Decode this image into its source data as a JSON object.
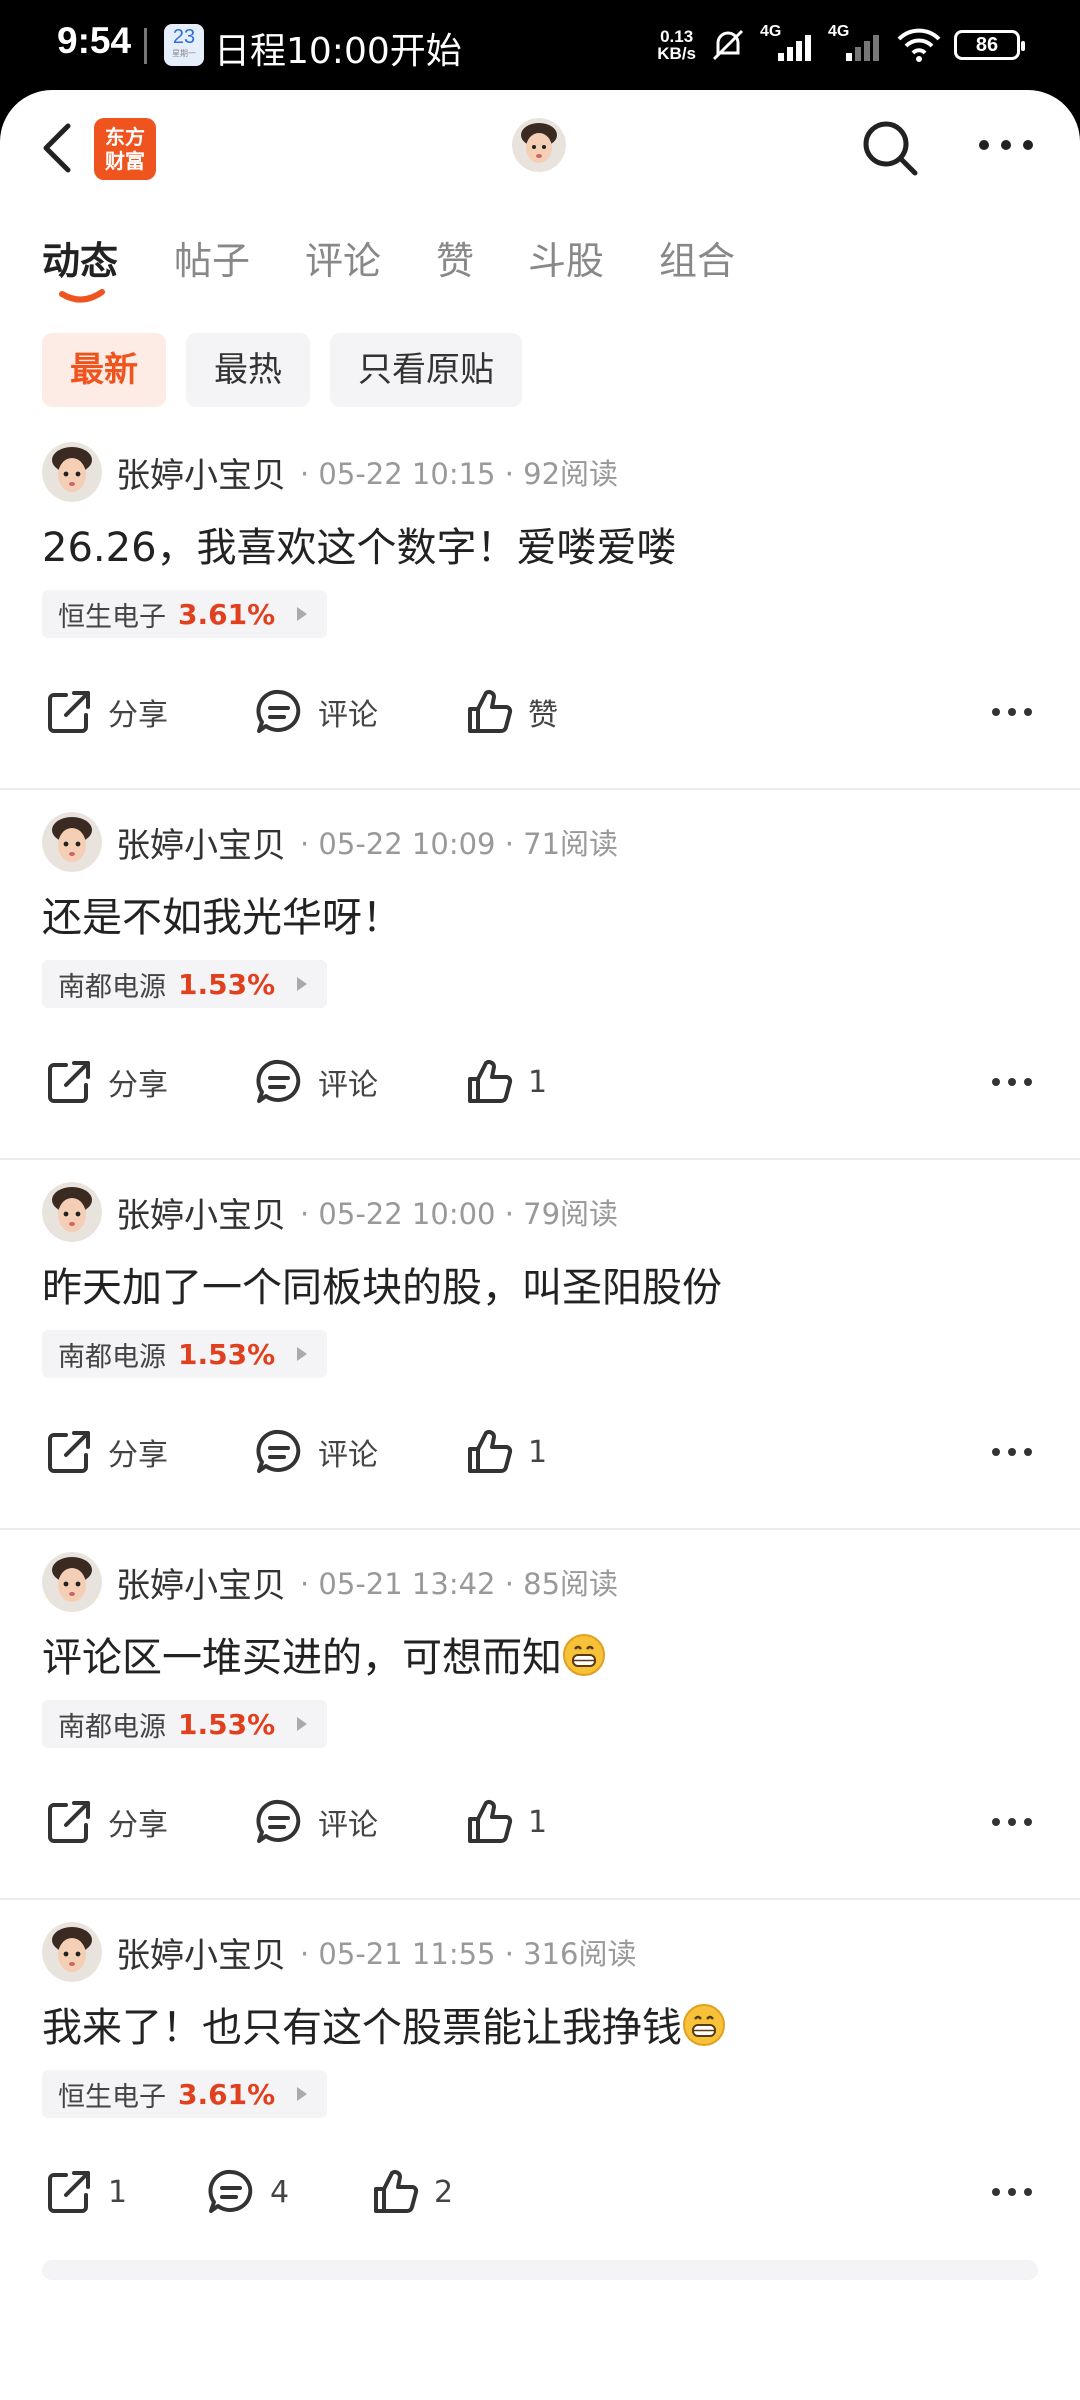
{
  "status_bar": {
    "time": "9:54",
    "calendar_day": "23",
    "calendar_sub": "星期一",
    "event": "日程10:00开始",
    "net_speed_value": "0.13",
    "net_speed_unit": "KB/s",
    "signal_1": "4G",
    "signal_2": "4G",
    "battery": "86"
  },
  "nav": {
    "logo_line1": "东方",
    "logo_line2": "财富"
  },
  "tabs": [
    "动态",
    "帖子",
    "评论",
    "赞",
    "斗股",
    "组合"
  ],
  "filters": [
    "最新",
    "最热",
    "只看原贴"
  ],
  "posts": [
    {
      "author": "张婷小宝贝",
      "meta": "· 05-22 10:15 · 92阅读",
      "text": "26.26，我喜欢这个数字！爱喽爱喽",
      "stock": "恒生电子",
      "pct": "3.61%",
      "share": "分享",
      "comment": "评论",
      "like": "赞"
    },
    {
      "author": "张婷小宝贝",
      "meta": "· 05-22 10:09 · 71阅读",
      "text": "还是不如我光华呀！",
      "stock": "南都电源",
      "pct": "1.53%",
      "share": "分享",
      "comment": "评论",
      "like": "1"
    },
    {
      "author": "张婷小宝贝",
      "meta": "· 05-22 10:00 · 79阅读",
      "text": "昨天加了一个同板块的股，叫圣阳股份",
      "stock": "南都电源",
      "pct": "1.53%",
      "share": "分享",
      "comment": "评论",
      "like": "1"
    },
    {
      "author": "张婷小宝贝",
      "meta": "· 05-21 13:42 · 85阅读",
      "text": "评论区一堆买进的，可想而知",
      "stock": "南都电源",
      "pct": "1.53%",
      "share": "分享",
      "comment": "评论",
      "like": "1"
    },
    {
      "author": "张婷小宝贝",
      "meta": "· 05-21 11:55 · 316阅读",
      "text": "我来了！也只有这个股票能让我挣钱",
      "stock": "恒生电子",
      "pct": "3.61%",
      "share": "1",
      "comment": "4",
      "like": "2"
    }
  ],
  "colors": {
    "accent": "#f0541e",
    "rise": "#e0401e"
  }
}
